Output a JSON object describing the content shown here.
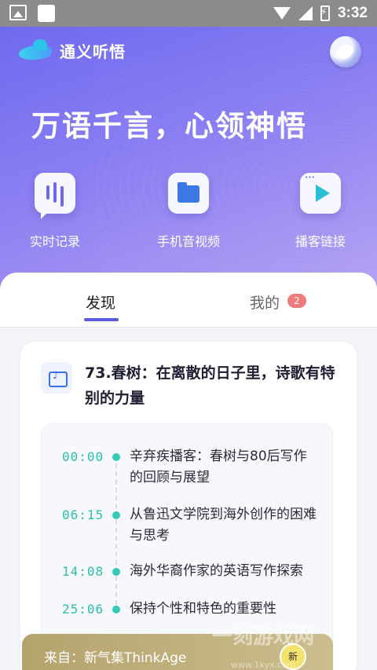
{
  "status_bar": {
    "time": "3:32"
  },
  "header": {
    "app_title": "通义听悟"
  },
  "hero": {
    "slogan": "万语千言，心领神悟"
  },
  "actions": [
    {
      "label": "实时记录",
      "icon": "mic-bubble-icon"
    },
    {
      "label": "手机音视频",
      "icon": "folder-icon"
    },
    {
      "label": "播客链接",
      "icon": "play-icon"
    }
  ],
  "tabs": [
    {
      "label": "发现",
      "active": true
    },
    {
      "label": "我的",
      "badge": "2"
    }
  ],
  "card": {
    "title": "73.春树：在离散的日子里，诗歌有特别的力量",
    "timeline": [
      {
        "time": "00:00",
        "text": "辛弃疾播客：春树与80后写作的回顾与展望"
      },
      {
        "time": "06:15",
        "text": "从鲁迅文学院到海外创作的困难与思考"
      },
      {
        "time": "14:08",
        "text": "海外华裔作家的英语写作探索"
      },
      {
        "time": "25:06",
        "text": "保持个性和特色的重要性"
      }
    ],
    "source": "来自：新气集ThinkAge"
  },
  "watermark": {
    "main": "一刻游戏网",
    "sub": "www.1kyx.com"
  },
  "colors": {
    "accent": "#5b59e0",
    "timeline": "#2bbfb0",
    "badge": "#f07b7b"
  }
}
